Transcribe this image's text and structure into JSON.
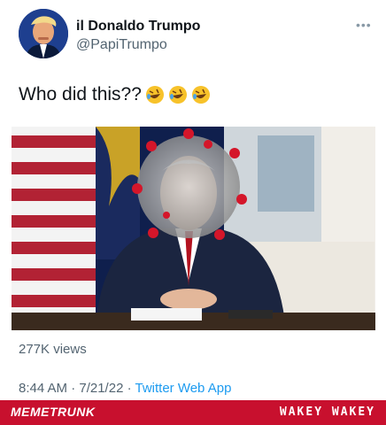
{
  "tweet": {
    "display_name": "il Donaldo Trumpo",
    "handle": "@PapiTrumpo",
    "more_icon": "more-horizontal-icon",
    "text": "Who did this??",
    "emojis": [
      "rolling-on-floor-laughing-emoji",
      "rolling-on-floor-laughing-emoji",
      "rolling-on-floor-laughing-emoji"
    ],
    "views": "277K views",
    "time": "8:44 AM · 7/21/22 · ",
    "source": "Twitter Web App"
  },
  "banner": {
    "left": "MEMETRUNK",
    "right": "WAKEY WAKEY"
  },
  "colors": {
    "link": "#1d9bf0",
    "banner_red": "#c8102e",
    "secondary_text": "#536471"
  }
}
